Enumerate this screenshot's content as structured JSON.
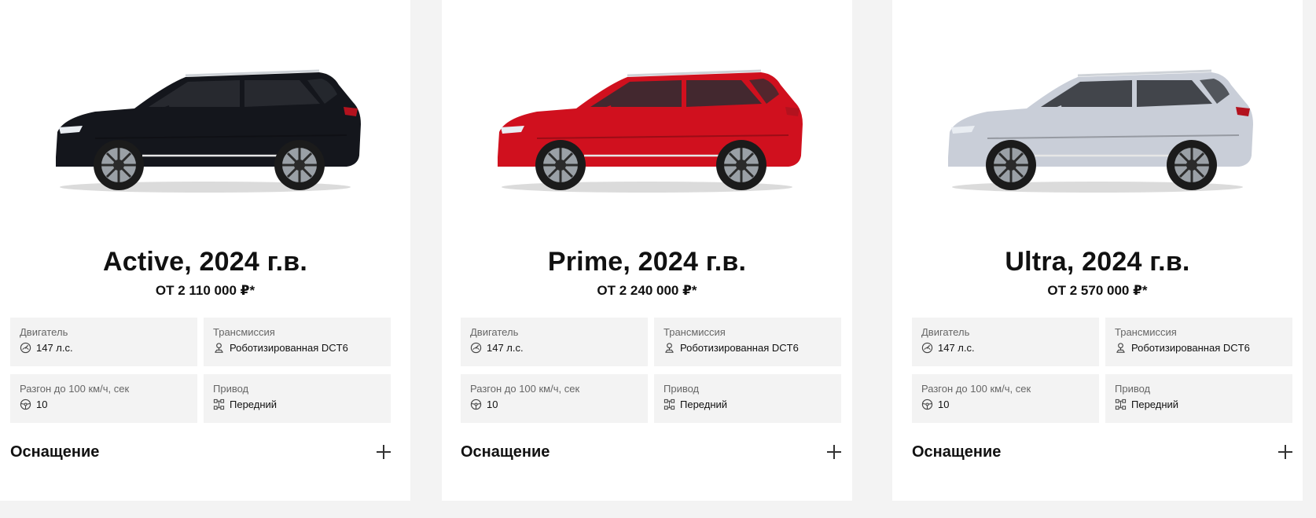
{
  "cards": [
    {
      "title": "Active, 2024 г.в.",
      "price": "ОТ 2 110 000 ₽*",
      "car_color": "#14161c",
      "specs": {
        "engine_label": "Двигатель",
        "engine_value": "147 л.с.",
        "trans_label": "Трансмиссия",
        "trans_value": "Роботизированная DCT6",
        "accel_label": "Разгон до 100 км/ч, сек",
        "accel_value": "10",
        "drive_label": "Привод",
        "drive_value": "Передний"
      },
      "equipment_label": "Оснащение"
    },
    {
      "title": "Prime, 2024 г.в.",
      "price": "ОТ 2 240 000 ₽*",
      "car_color": "#d0101e",
      "specs": {
        "engine_label": "Двигатель",
        "engine_value": "147 л.с.",
        "trans_label": "Трансмиссия",
        "trans_value": "Роботизированная DCT6",
        "accel_label": "Разгон до 100 км/ч, сек",
        "accel_value": "10",
        "drive_label": "Привод",
        "drive_value": "Передний"
      },
      "equipment_label": "Оснащение"
    },
    {
      "title": "Ultra, 2024 г.в.",
      "price": "ОТ 2 570 000 ₽*",
      "car_color": "#c9ced8",
      "specs": {
        "engine_label": "Двигатель",
        "engine_value": "147 л.с.",
        "trans_label": "Трансмиссия",
        "trans_value": "Роботизированная DCT6",
        "accel_label": "Разгон до 100 км/ч, сек",
        "accel_value": "10",
        "drive_label": "Привод",
        "drive_value": "Передний"
      },
      "equipment_label": "Оснащение"
    }
  ],
  "icons": {
    "engine": "speedometer-icon",
    "transmission": "gearshift-icon",
    "acceleration": "steering-wheel-icon",
    "drive": "drivetrain-icon",
    "expand": "plus-icon"
  }
}
